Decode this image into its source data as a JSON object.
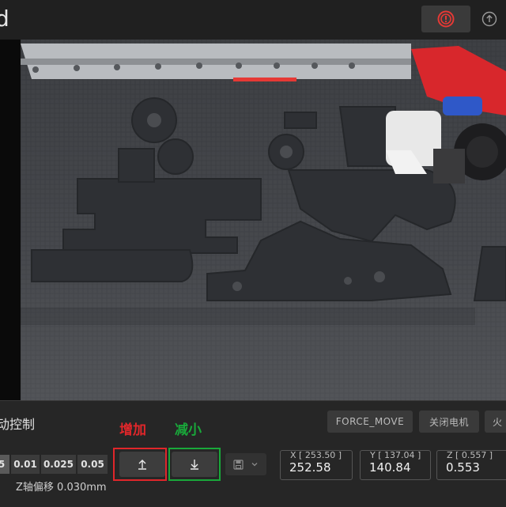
{
  "header": {
    "title_fragment": "d",
    "estop_icon": "emergency-stop-icon",
    "upload_icon": "upload-icon"
  },
  "panel": {
    "title": "动控制",
    "force_move_label": "FORCE_MOVE",
    "motors_off_label": "关闭电机",
    "extra_label": "火",
    "step_sizes": [
      "5",
      "0.01",
      "0.025",
      "0.05"
    ],
    "selected_step": "5",
    "annotation_increase": "增加",
    "annotation_decrease": "减小",
    "annotation_colors": {
      "increase": "#e0262a",
      "decrease": "#19a83a"
    },
    "up_icon": "arrow-up-icon",
    "down_icon": "arrow-down-icon",
    "save_icon": "save-icon",
    "chevron_icon": "chevron-down-icon",
    "positions": [
      {
        "label": "X [ 253.50 ]",
        "value": "252.58"
      },
      {
        "label": "Y [ 137.04 ]",
        "value": "140.84"
      },
      {
        "label": "Z [ 0.557 ]",
        "value": "0.553"
      }
    ],
    "z_offset_label": "Z轴偏移",
    "z_offset_value": "0.030mm"
  }
}
